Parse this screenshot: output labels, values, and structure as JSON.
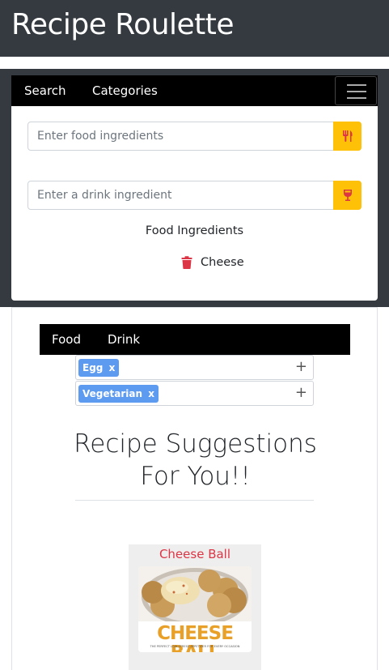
{
  "header": {
    "title": "Recipe Roulette"
  },
  "nav": {
    "search": "Search",
    "categories": "Categories"
  },
  "search": {
    "food_placeholder": "Enter food ingredients",
    "drink_placeholder": "Enter a drink ingredient",
    "food_heading": "Food Ingredients",
    "ingredients": [
      "Cheese"
    ]
  },
  "tabs": {
    "food": "Food",
    "drink": "Drink"
  },
  "filters": {
    "row1_tags": [
      {
        "label": "Egg",
        "remove": "x"
      }
    ],
    "row2_tags": [
      {
        "label": "Vegetarian",
        "remove": "x"
      }
    ],
    "add": "+"
  },
  "suggestions": {
    "title_line1": "Recipe Suggestions",
    "title_line2": "For You!!",
    "recipes": [
      {
        "name": "Cheese Ball",
        "image_title": "CHEESE BALL",
        "image_subtitle": "THE PERFECT LOW-STRESS APPETIZER FOR EVERY OCCASION"
      }
    ]
  },
  "colors": {
    "dark": "#343a40",
    "accent": "#ffc107",
    "danger": "#dc3545",
    "tag": "#5c9bf0"
  }
}
